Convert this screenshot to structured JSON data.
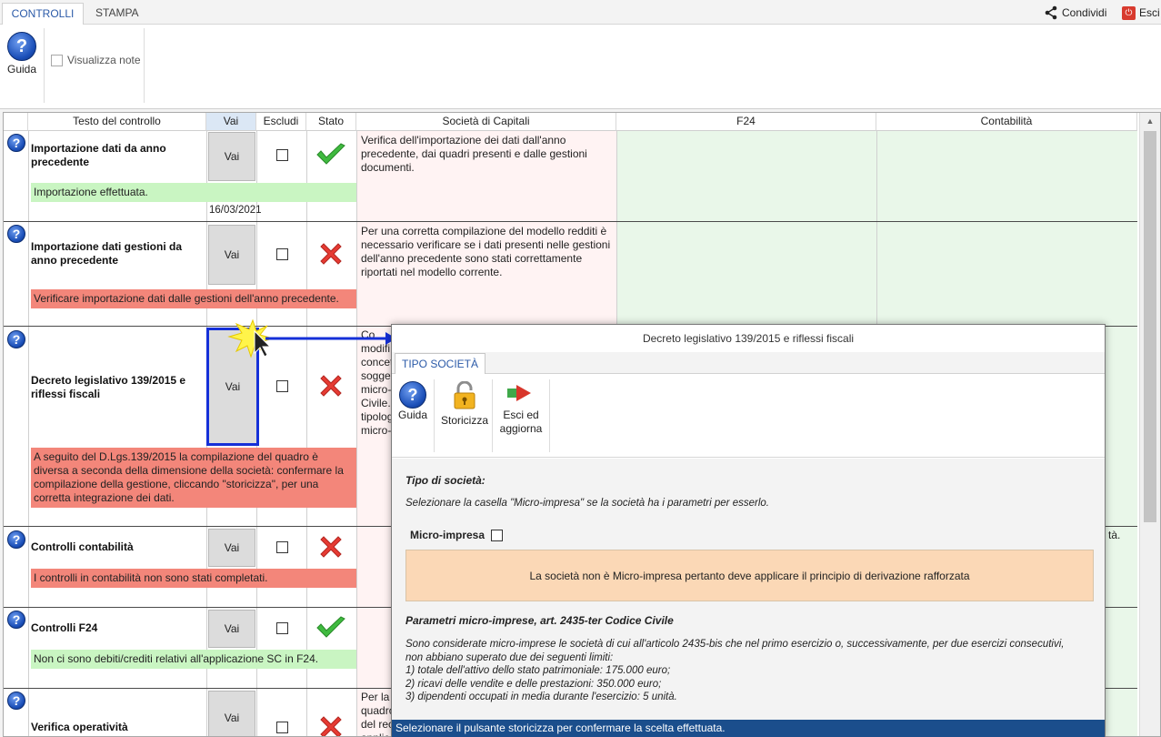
{
  "ribbon": {
    "tabs": [
      "CONTROLLI",
      "STAMPA"
    ],
    "share_label": "Condividi",
    "exit_label": "Esci",
    "guide_label": "Guida",
    "show_notes_label": "Visualizza note"
  },
  "grid": {
    "headers": [
      "Testo del controllo",
      "Vai",
      "Escludi",
      "Stato",
      "Società di Capitali",
      "F24",
      "Contabilità"
    ],
    "rows": [
      {
        "title": "Importazione dati da anno precedente",
        "vai": "Vai",
        "status": "ok",
        "message": "Importazione effettuata.",
        "date": "16/03/2021",
        "description": "Verifica dell'importazione dei dati dall'anno precedente, dai quadri presenti e dalle gestioni documenti."
      },
      {
        "title": "Importazione dati gestioni da anno precedente",
        "vai": "Vai",
        "status": "error",
        "message": "Verificare importazione dati dalle gestioni dell'anno precedente.",
        "description": "Per una corretta compilazione del modello redditi è necessario verificare se i dati presenti nelle gestioni dell'anno precedente sono stati correttamente riportati nel modello corrente."
      },
      {
        "title": "Decreto legislativo 139/2015 e riflessi fiscali",
        "vai": "Vai",
        "status": "error",
        "message": "A seguito del D.Lgs.139/2015 la compilazione del quadro è diversa a seconda della dimensione della società: confermare la compilazione della gestione, cliccando \"storicizza\", per una corretta integrazione dei dati.",
        "description_fragments": [
          "Co",
          "modifi",
          "concet",
          "sogget",
          "micro-",
          "Civile.",
          "tipolog",
          "micro-"
        ]
      },
      {
        "title": "Controlli contabilità",
        "vai": "Vai",
        "status": "error",
        "message": "I controlli in contabilità non sono stati completati.",
        "right_fragment": "tà."
      },
      {
        "title": "Controlli F24",
        "vai": "Vai",
        "status": "ok",
        "message": "Non ci sono debiti/crediti relativi all'applicazione SC in F24."
      },
      {
        "title": "Verifica operatività",
        "vai": "Vai",
        "status": "error",
        "description_fragments": [
          "Per la",
          "quadro",
          "del rec",
          "applica"
        ]
      }
    ]
  },
  "dialog": {
    "title": "Decreto legislativo 139/2015 e riflessi fiscali",
    "tab": "TIPO SOCIETÀ",
    "buttons": {
      "guide": "Guida",
      "storicizza": "Storicizza",
      "exit_line1": "Esci ed",
      "exit_line2": "aggiorna"
    },
    "section1_title": "Tipo di società:",
    "section1_text": "Selezionare la casella \"Micro-impresa\" se la società ha i parametri per esserlo.",
    "micro_label": "Micro-impresa",
    "notice": "La società non è Micro-impresa pertanto deve applicare il principio di derivazione rafforzata",
    "section2_title": "Parametri micro-imprese, art. 2435-ter Codice Civile",
    "section2_lines": [
      "Sono considerate micro-imprese le società di cui all'articolo 2435-bis che nel primo esercizio o, successivamente, per due esercizi consecutivi,",
      "non abbiano superato due dei seguenti limiti:",
      "1) totale dell'attivo dello stato patrimoniale: 175.000 euro;",
      "2) ricavi delle vendite e delle prestazioni: 350.000 euro;",
      "3) dipendenti occupati in media durante l'esercizio: 5 unità."
    ],
    "status_bar": "Selezionare il pulsante storicizza per confermare la scelta effettuata."
  },
  "colors": {
    "accent_blue": "#2b5aa8",
    "ok_green": "#c9f5c2",
    "error_red": "#f3867a",
    "notice_orange": "#fbd8b6",
    "status_bar": "#1b4e8c"
  }
}
